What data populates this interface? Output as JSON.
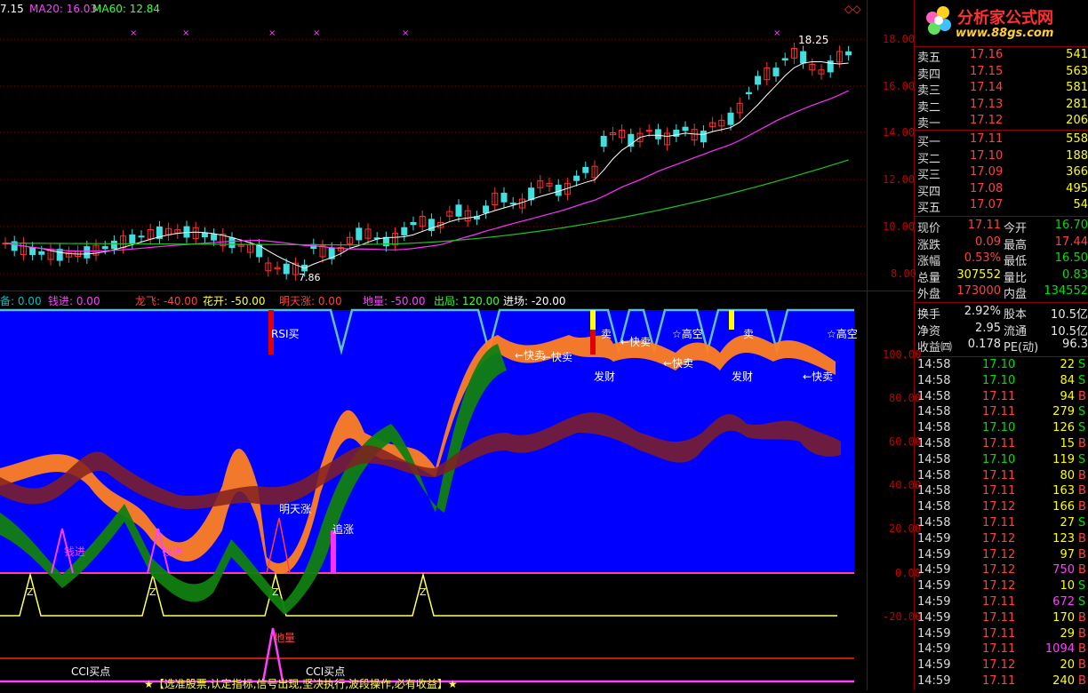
{
  "price_header": {
    "price_label": "7.15",
    "ma20_label": "MA20: 16.03",
    "ma60_label": "MA60: 12.84",
    "high_marker": "18.25",
    "low_marker": "7.86",
    "corner_icon": "◇◇"
  },
  "price_axis": [
    "18.00",
    "16.00",
    "14.00",
    "12.00",
    "10.00",
    "8.00"
  ],
  "indicator_header": {
    "items": [
      {
        "text": "备: 0.00",
        "color": "#00c0c0"
      },
      {
        "text": "钱进: 0.00",
        "color": "#ff40ff"
      },
      {
        "text": "龙飞: -40.00",
        "color": "#ff4040"
      },
      {
        "text": "花开: -50.00",
        "color": "#ffff40"
      },
      {
        "text": "明天涨: 0.00",
        "color": "#ff4040"
      },
      {
        "text": "地量: -50.00",
        "color": "#ff40ff"
      },
      {
        "text": "出局: 120.00",
        "color": "#40ff40"
      },
      {
        "text": "进场: -20.00",
        "color": "#ffffff"
      }
    ]
  },
  "indicator_axis": [
    "100.00",
    "80.00",
    "60.00",
    "40.00",
    "20.00",
    "0.00",
    "-20.00"
  ],
  "indicator_labels": {
    "rsi_buy": "RSI买",
    "tomorrow_up": "明天涨",
    "chase_up": "追涨",
    "money_in_1": "钱进",
    "money_in_2": "钱进",
    "di_liang": "地量",
    "cci_buy_1": "CCI买点",
    "cci_buy_2": "CCI买点",
    "quick_sell_1": "←快卖",
    "quick_sell_2": "←快卖",
    "quick_sell_3": "←快卖",
    "quick_sell_4": "←快卖",
    "quick_sell_5": "←快卖",
    "high_empty_1": "☆高空",
    "high_empty_2": "☆高空",
    "fa_cai_1": "发财",
    "fa_cai_2": "发财",
    "sell_1": "卖",
    "sell_2": "卖",
    "z": "Z",
    "slogan": "★【选准股票,认定指标,信号出现,坚决执行,波段操作,必有收益】★"
  },
  "logo": {
    "brand": "分析家公式网",
    "url": "www.88gs.com"
  },
  "order_book": {
    "sell": [
      {
        "label": "卖五",
        "price": "17.16",
        "vol": "541"
      },
      {
        "label": "卖四",
        "price": "17.15",
        "vol": "563"
      },
      {
        "label": "卖三",
        "price": "17.14",
        "vol": "581"
      },
      {
        "label": "卖二",
        "price": "17.13",
        "vol": "281"
      },
      {
        "label": "卖一",
        "price": "17.12",
        "vol": "206"
      }
    ],
    "buy": [
      {
        "label": "买一",
        "price": "17.11",
        "vol": "558"
      },
      {
        "label": "买二",
        "price": "17.10",
        "vol": "188"
      },
      {
        "label": "买三",
        "price": "17.09",
        "vol": "366"
      },
      {
        "label": "买四",
        "price": "17.08",
        "vol": "495"
      },
      {
        "label": "买五",
        "price": "17.07",
        "vol": "54"
      }
    ]
  },
  "quote": [
    {
      "l1": "现价",
      "v1": "17.11",
      "c1": "up",
      "l2": "今开",
      "v2": "16.70",
      "c2": "down"
    },
    {
      "l1": "涨跌",
      "v1": "0.09",
      "c1": "up",
      "l2": "最高",
      "v2": "17.44",
      "c2": "up"
    },
    {
      "l1": "涨幅",
      "v1": "0.53%",
      "c1": "up",
      "l2": "最低",
      "v2": "16.50",
      "c2": "down"
    },
    {
      "l1": "总量",
      "v1": "307552",
      "c1": "yel",
      "l2": "量比",
      "v2": "0.83",
      "c2": "down"
    },
    {
      "l1": "外盘",
      "v1": "173000",
      "c1": "up",
      "l2": "内盘",
      "v2": "134552",
      "c2": "down"
    }
  ],
  "stats": [
    {
      "l1": "换手",
      "v1": "2.92%",
      "l2": "股本",
      "v2": "10.5亿"
    },
    {
      "l1": "净资",
      "v1": "2.95",
      "l2": "流通",
      "v2": "10.5亿"
    },
    {
      "l1": "收益㈣",
      "v1": "0.178",
      "l2": "PE(动)",
      "v2": "96.3"
    }
  ],
  "ticks": [
    {
      "time": "14:58",
      "price": "17.10",
      "pc": "down",
      "vol": "22",
      "vc": "yel",
      "side": "S"
    },
    {
      "time": "14:58",
      "price": "17.10",
      "pc": "down",
      "vol": "84",
      "vc": "yel",
      "side": "S"
    },
    {
      "time": "14:58",
      "price": "17.11",
      "pc": "up",
      "vol": "94",
      "vc": "yel",
      "side": "B"
    },
    {
      "time": "14:58",
      "price": "17.11",
      "pc": "up",
      "vol": "279",
      "vc": "yel",
      "side": "S"
    },
    {
      "time": "14:58",
      "price": "17.10",
      "pc": "down",
      "vol": "126",
      "vc": "yel",
      "side": "S"
    },
    {
      "time": "14:58",
      "price": "17.11",
      "pc": "up",
      "vol": "15",
      "vc": "yel",
      "side": "B"
    },
    {
      "time": "14:58",
      "price": "17.10",
      "pc": "down",
      "vol": "119",
      "vc": "yel",
      "side": "S"
    },
    {
      "time": "14:58",
      "price": "17.11",
      "pc": "up",
      "vol": "80",
      "vc": "yel",
      "side": "B"
    },
    {
      "time": "14:58",
      "price": "17.11",
      "pc": "up",
      "vol": "163",
      "vc": "yel",
      "side": "B"
    },
    {
      "time": "14:58",
      "price": "17.12",
      "pc": "up",
      "vol": "166",
      "vc": "yel",
      "side": "B"
    },
    {
      "time": "14:58",
      "price": "17.11",
      "pc": "up",
      "vol": "27",
      "vc": "yel",
      "side": "S"
    },
    {
      "time": "14:59",
      "price": "17.12",
      "pc": "up",
      "vol": "123",
      "vc": "yel",
      "side": "B"
    },
    {
      "time": "14:59",
      "price": "17.12",
      "pc": "up",
      "vol": "97",
      "vc": "yel",
      "side": "B"
    },
    {
      "time": "14:59",
      "price": "17.12",
      "pc": "up",
      "vol": "750",
      "vc": "mag",
      "side": "B"
    },
    {
      "time": "14:59",
      "price": "17.12",
      "pc": "up",
      "vol": "10",
      "vc": "yel",
      "side": "S"
    },
    {
      "time": "14:59",
      "price": "17.11",
      "pc": "up",
      "vol": "672",
      "vc": "mag",
      "side": "S"
    },
    {
      "time": "14:59",
      "price": "17.11",
      "pc": "up",
      "vol": "170",
      "vc": "yel",
      "side": "B"
    },
    {
      "time": "14:59",
      "price": "17.11",
      "pc": "up",
      "vol": "29",
      "vc": "yel",
      "side": "B"
    },
    {
      "time": "14:59",
      "price": "17.11",
      "pc": "up",
      "vol": "1094",
      "vc": "mag",
      "side": "B"
    },
    {
      "time": "14:59",
      "price": "17.12",
      "pc": "up",
      "vol": "20",
      "vc": "yel",
      "side": "B"
    },
    {
      "time": "14:59",
      "price": "17.11",
      "pc": "up",
      "vol": "240",
      "vc": "yel",
      "side": "B"
    }
  ],
  "colors": {
    "up": "#ff4040",
    "down": "#00e000",
    "grid": "#8b0000",
    "indicator_bg": "#0000ff"
  }
}
